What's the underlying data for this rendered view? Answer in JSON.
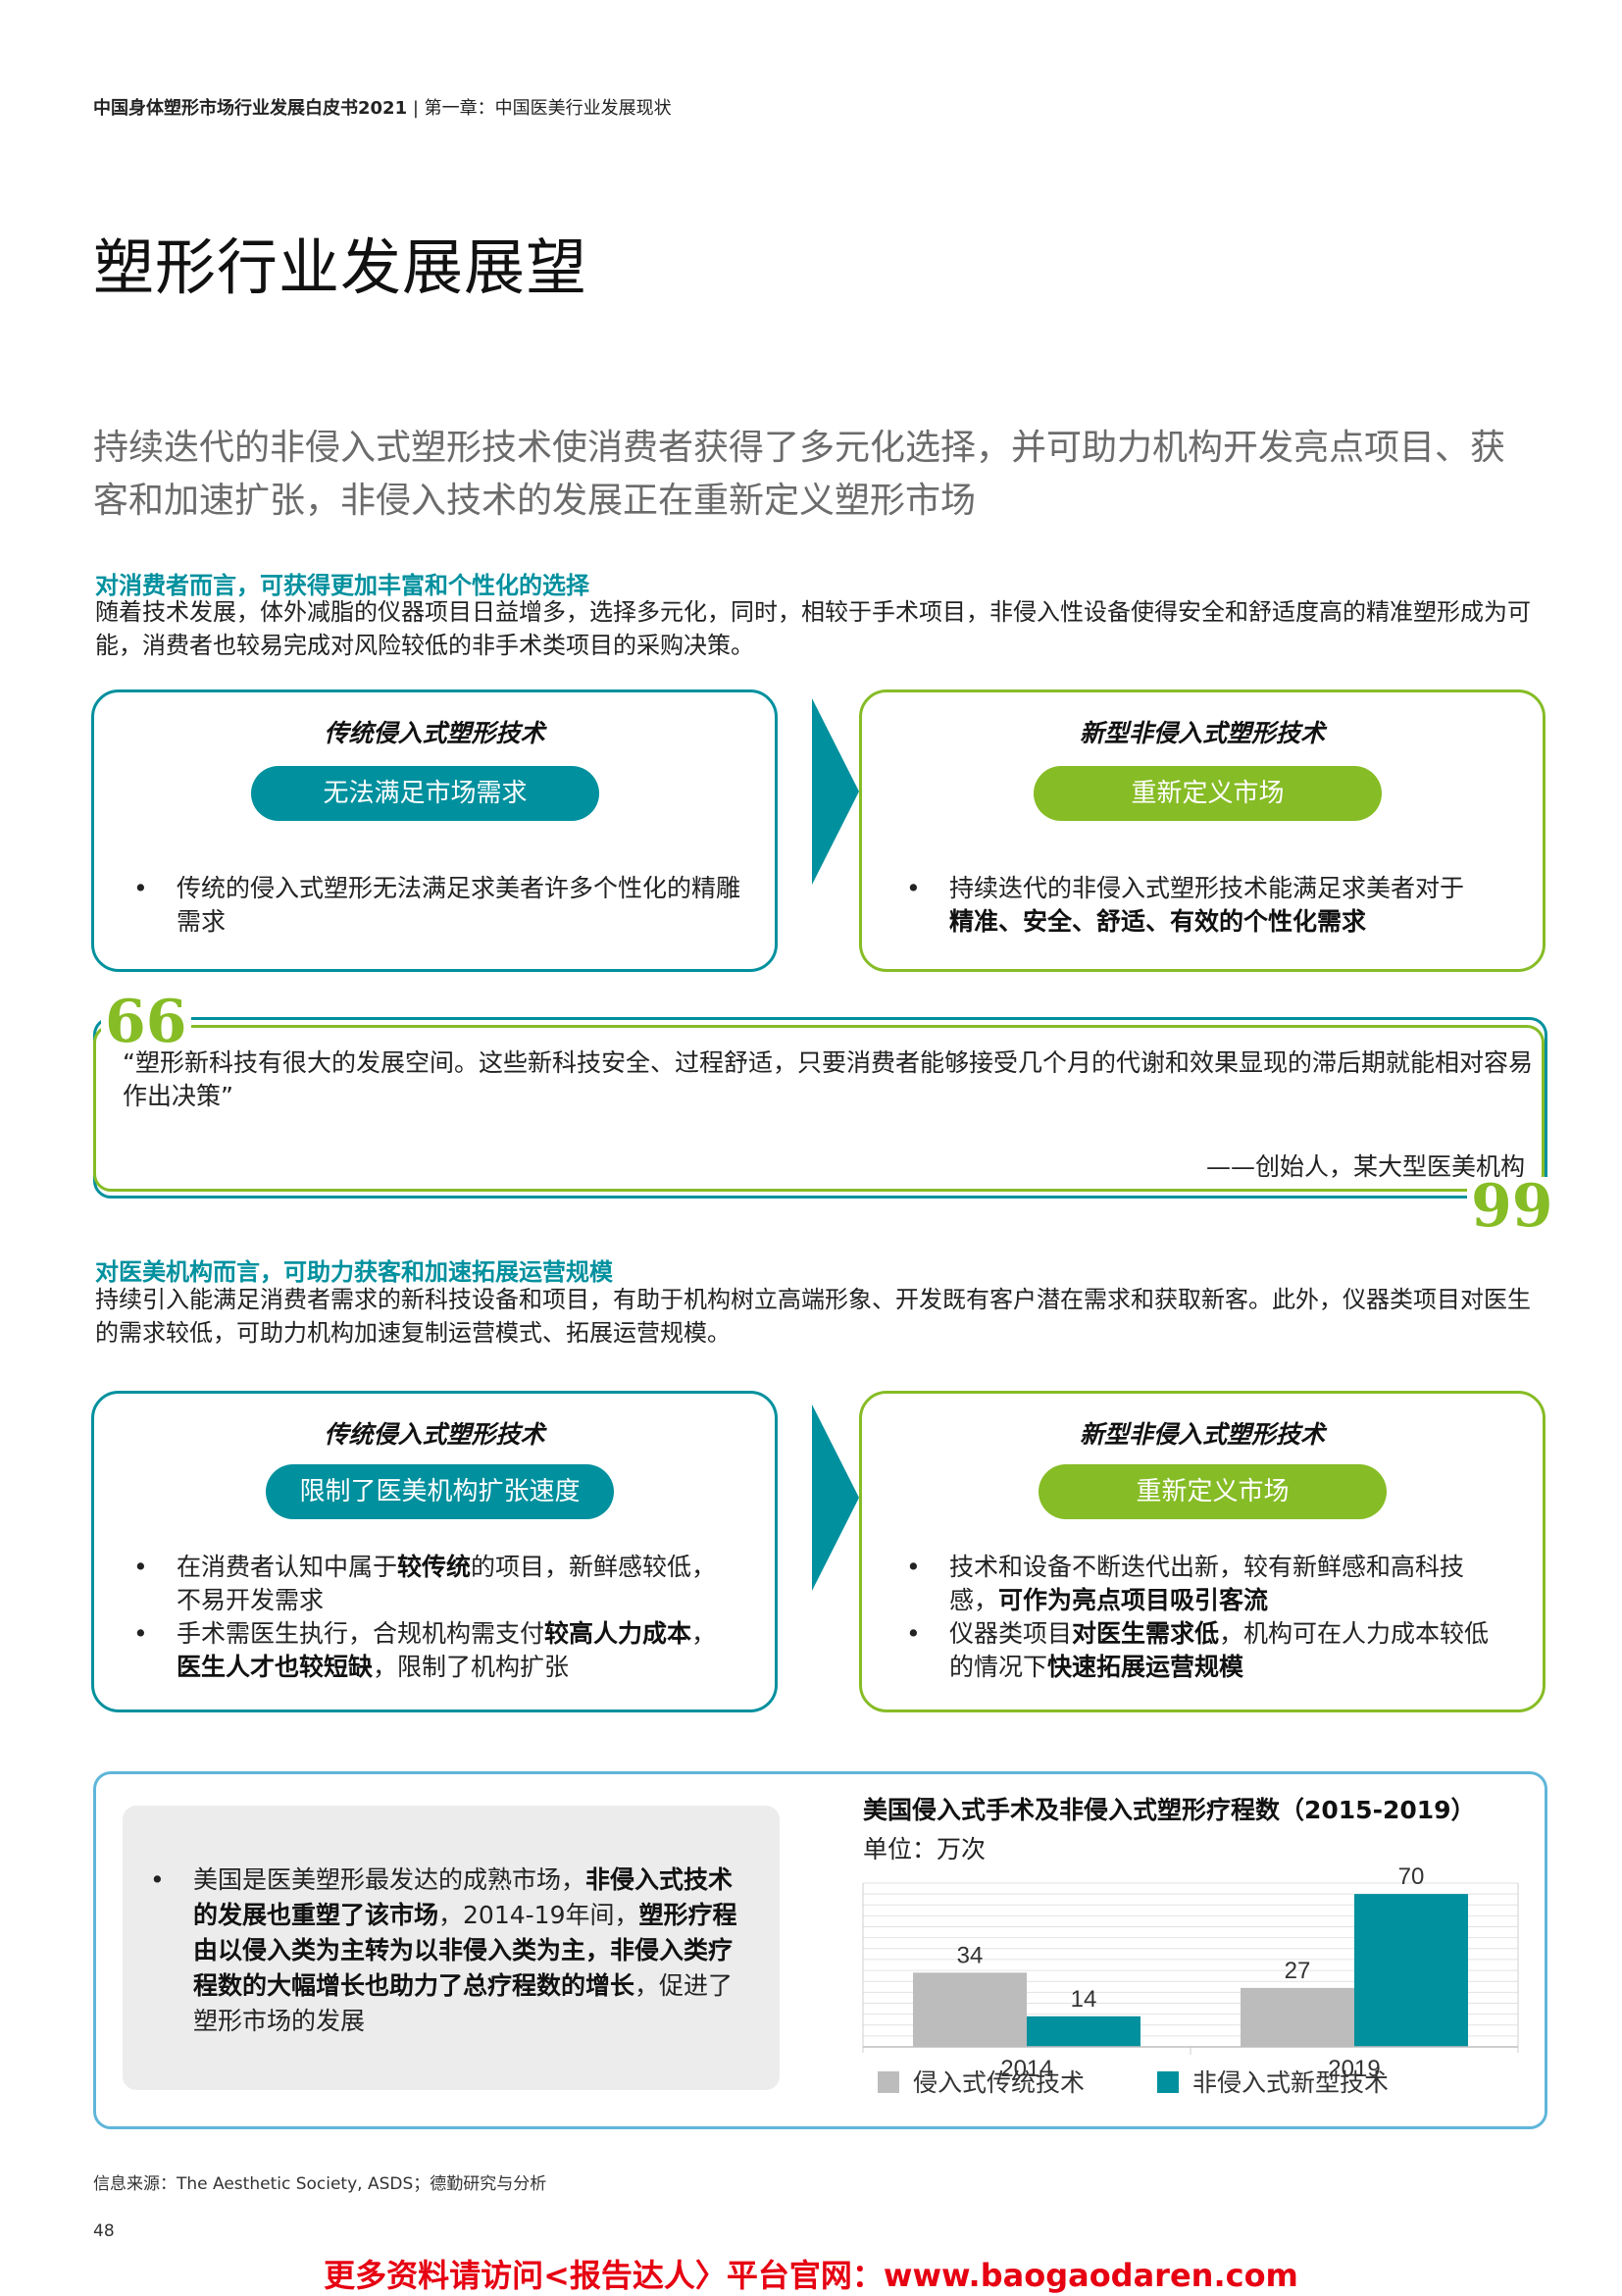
{
  "header": {
    "report": "中国身体塑形市场行业发展白皮书2021",
    "separator": "|",
    "chapter": "第一章：中国医美行业发展现状"
  },
  "title": "塑形行业发展展望",
  "lead": "持续迭代的非侵入式塑形技术使消费者获得了多元化选择，并可助力机构开发亮点项目、获客和加速扩张，非侵入技术的发展正在重新定义塑形市场",
  "consumer": {
    "heading": "对消费者而言，可获得更加丰富和个性化的选择",
    "body": "随着技术发展，体外减脂的仪器项目日益增多，选择多元化，同时，相较于手术项目，非侵入性设备使得安全和舒适度高的精准塑形成为可能，消费者也较易完成对风险较低的非手术类项目的采购决策。",
    "left_card": {
      "title": "传统侵入式塑形技术",
      "pill": "无法满足市场需求",
      "bullet": "传统的侵入式塑形无法满足求美者许多个性化的精雕需求"
    },
    "right_card": {
      "title": "新型非侵入式塑形技术",
      "pill": "重新定义市场",
      "bullet_plain": "持续迭代的非侵入式塑形技术能满足求美者对于",
      "bullet_bold": "精准、安全、舒适、有效的个性化需求"
    }
  },
  "quote": {
    "open_mark": "66",
    "close_mark": "99",
    "text": "“塑形新科技有很大的发展空间。这些新科技安全、过程舒适，只要消费者能够接受几个月的代谢和效果显现的滞后期就能相对容易作出决策”",
    "attribution": "——创始人，某大型医美机构"
  },
  "institution": {
    "heading": "对医美机构而言，可助力获客和加速拓展运营规模",
    "body": "持续引入能满足消费者需求的新科技设备和项目，有助于机构树立高端形象、开发既有客户潜在需求和获取新客。此外，仪器类项目对医生的需求较低，可助力机构加速复制运营模式、拓展运营规模。",
    "left_card": {
      "title": "传统侵入式塑形技术",
      "pill": "限制了医美机构扩张速度",
      "b1_a": "在消费者认知中属于",
      "b1_b": "较传统",
      "b1_c": "的项目，新鲜感较低，不易开发需求",
      "b2_a": "手术需医生执行，合规机构需支付",
      "b2_b": "较高人力成本",
      "b2_c": "，",
      "b2_d": "医生人才也较短缺",
      "b2_e": "，限制了机构扩张"
    },
    "right_card": {
      "title": "新型非侵入式塑形技术",
      "pill": "重新定义市场",
      "b1_a": "技术和设备不断迭代出新，较有新鲜感和高科技感，",
      "b1_b": "可作为亮点项目吸引客流",
      "b2_a": "仪器类项目",
      "b2_b": "对医生需求低",
      "b2_c": "，机构可在人力成本较低的情况下",
      "b2_d": "快速拓展运营规模"
    }
  },
  "us_box": {
    "b_a": "美国是医美塑形最发达的成熟市场，",
    "b_b": "非侵入式技术的发展也重塑了该市场",
    "b_c": "，2014-19年间，",
    "b_d": "塑形疗程由以侵入类为主转为以非侵入类为主，非侵入类疗程数的大幅增长也助力了总疗程数的增长",
    "b_e": "，促进了塑形市场的发展"
  },
  "chart_data": {
    "type": "bar",
    "title": "美国侵入式手术及非侵入式塑形疗程数（2015-2019）",
    "unit_label": "单位：万次",
    "categories": [
      "2014",
      "2019"
    ],
    "series": [
      {
        "name": "侵入式传统技术",
        "values": [
          34,
          27
        ],
        "color": "#bcbcbc"
      },
      {
        "name": "非侵入式新型技术",
        "values": [
          14,
          70
        ],
        "color": "#00909e"
      }
    ],
    "ylim": [
      0,
      75
    ],
    "grid": true,
    "legend": "bottom"
  },
  "footer": {
    "source": "信息来源：The Aesthetic Society, ASDS；德勤研究与分析",
    "page": "48",
    "promo": "更多资料请访问<报告达人〉平台官网：www.baogaodaren.com"
  }
}
